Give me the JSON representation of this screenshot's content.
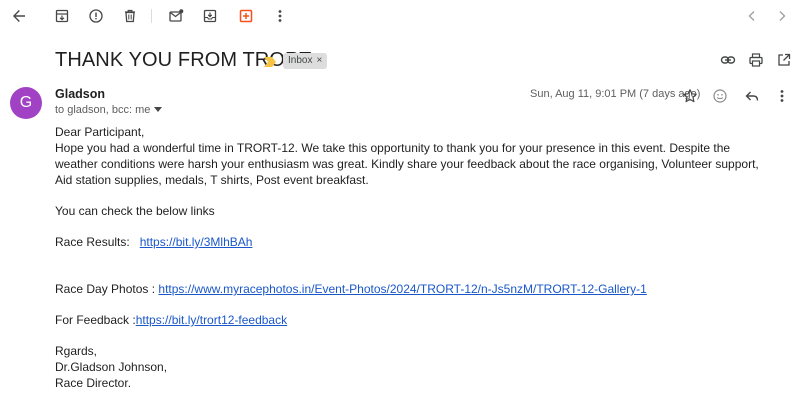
{
  "toolbar": {
    "back_icon": "arrow-left-icon",
    "archive_icon": "archive-icon",
    "report_spam_icon": "report-spam-icon",
    "delete_icon": "trash-icon",
    "mark_unread_icon": "mark-unread-icon",
    "move_to_icon": "move-to-inbox-icon",
    "add_to_tasks_icon": "add-to-tasks-icon",
    "more_icon": "more-vertical-icon",
    "prev_icon": "chevron-left-icon",
    "next_icon": "chevron-right-icon",
    "accent_color": "#f4511e"
  },
  "email": {
    "subject": "THANK YOU FROM TRORT",
    "label": "Inbox",
    "label_close": "×",
    "sender_initial": "G",
    "sender_name": "Gladson",
    "recipients": "to gladson, bcc: me",
    "date": "Sun, Aug 11, 9:01 PM (7 days ago)",
    "avatar_color": "#a142c4",
    "body": {
      "greeting": "Dear Participant,",
      "paragraph": "Hope you had a wonderful time in TRORT-12. We take this opportunity to thank you for your presence in this event. Despite the weather conditions were harsh your enthusiasm was great. Kindly share your feedback about the race organising, Volunteer support, Aid station supplies, medals, T shirts, Post event breakfast.",
      "links_intro": "You can check the below links",
      "results_label": "Race Results:",
      "results_link": "https://bit.ly/3MlhBAh",
      "photos_label": "Race Day Photos :",
      "photos_link": "https://www.myracephotos.in/Event-Photos/2024/TRORT-12/n-Js5nzM/TRORT-12-Gallery-1",
      "feedback_label": "For Feedback :",
      "feedback_link": "https://bit.ly/trort12-feedback",
      "signoff": "Rgards,",
      "signer": "Dr.Gladson Johnson,",
      "signer_title": "Race Director."
    }
  }
}
